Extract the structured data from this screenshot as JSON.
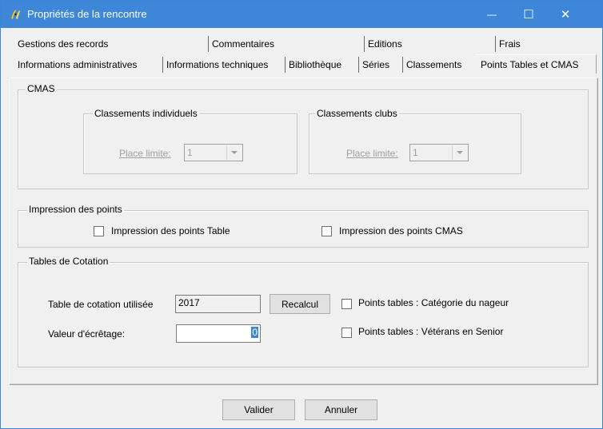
{
  "window": {
    "title": "Propriétés de la rencontre",
    "minimize_glyph": "—",
    "maximize_glyph": "☐",
    "close_glyph": "✕"
  },
  "tabs_row1": [
    {
      "label": "Gestions des records"
    },
    {
      "label": "Commentaires"
    },
    {
      "label": "Editions"
    },
    {
      "label": "Frais"
    }
  ],
  "tabs_row2": [
    {
      "label": "Informations administratives"
    },
    {
      "label": "Informations techniques"
    },
    {
      "label": "Bibliothèque"
    },
    {
      "label": "Séries"
    },
    {
      "label": "Classements"
    },
    {
      "label": "Points Tables et CMAS",
      "active": true
    }
  ],
  "cmas": {
    "legend": "CMAS",
    "individuels": {
      "legend": "Classements individuels",
      "place_limite_label": "Place limite:",
      "place_limite_value": "1"
    },
    "clubs": {
      "legend": "Classements clubs",
      "place_limite_label": "Place limite:",
      "place_limite_value": "1"
    }
  },
  "impression": {
    "legend": "Impression des points",
    "points_table_label": "Impression des points Table",
    "points_cmas_label": "Impression des points CMAS"
  },
  "tables": {
    "legend": "Tables de Cotation",
    "table_utilisee_label": "Table de cotation utilisée",
    "table_utilisee_value": "2017",
    "recalcul_label": "Recalcul",
    "ecretage_label": "Valeur d'écrêtage:",
    "ecretage_value": "0",
    "categorie_label": "Points tables : Catégorie du nageur",
    "veterans_label": "Points tables : Vétérans en Senior"
  },
  "footer": {
    "valider_label": "Valider",
    "annuler_label": "Annuler"
  },
  "colors": {
    "titlebar": "#3d86d8",
    "dialog_bg": "#f0f0f0",
    "disabled_text": "#a0a0a0"
  }
}
